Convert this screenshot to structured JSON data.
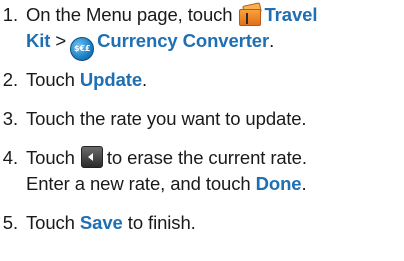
{
  "steps": [
    {
      "num": "1.",
      "pre": "On the Menu page, touch",
      "travel": "Travel",
      "kit": "Kit",
      "sep": ">",
      "currency": "Currency Converter",
      "end": ".",
      "icon_kit": "travel-kit-suitcase-icon",
      "icon_currency": "currency-converter-icon",
      "icon_currency_text": "$€£"
    },
    {
      "num": "2.",
      "pre": "Touch",
      "hl": "Update",
      "end": "."
    },
    {
      "num": "3.",
      "text": "Touch the rate you want to update."
    },
    {
      "num": "4.",
      "pre": "Touch",
      "post": "to erase the current rate.",
      "line2_pre": "Enter a new rate, and touch",
      "hl": "Done",
      "end": ".",
      "icon_back": "back-arrow-icon"
    },
    {
      "num": "5.",
      "pre": "Touch",
      "hl": "Save",
      "end": "to finish."
    }
  ],
  "colors": {
    "highlight": "#1f6fb4",
    "text": "#1a1a1a"
  }
}
